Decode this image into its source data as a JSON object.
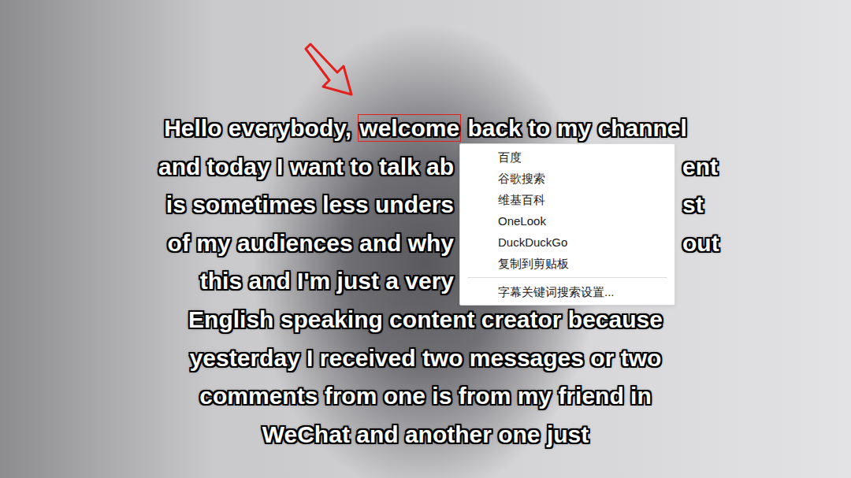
{
  "subtitles": {
    "lines": [
      {
        "kind": "highlight",
        "before": "Hello everybody, ",
        "word": "welcome",
        "after": " back to my channel",
        "selected": true
      },
      {
        "kind": "split",
        "left": "and today I want to talk ab",
        "right": "ent"
      },
      {
        "kind": "split",
        "left": "is sometimes less unders",
        "right": "st"
      },
      {
        "kind": "split",
        "left": "of my audiences and why",
        "right": "out"
      },
      {
        "kind": "split",
        "left": "this and I'm just a very"
      },
      {
        "kind": "full",
        "text": "English speaking content creator because"
      },
      {
        "kind": "full",
        "text": "yesterday I received two messages or two"
      },
      {
        "kind": "full",
        "text": "comments from one is from my friend in"
      },
      {
        "kind": "full",
        "text": "WeChat and another one just"
      }
    ]
  },
  "context_menu": {
    "items": [
      "百度",
      "谷歌搜索",
      "维基百科",
      "OneLook",
      "DuckDuckGo",
      "复制到剪贴板"
    ],
    "settings": "字幕关键词搜索设置..."
  }
}
